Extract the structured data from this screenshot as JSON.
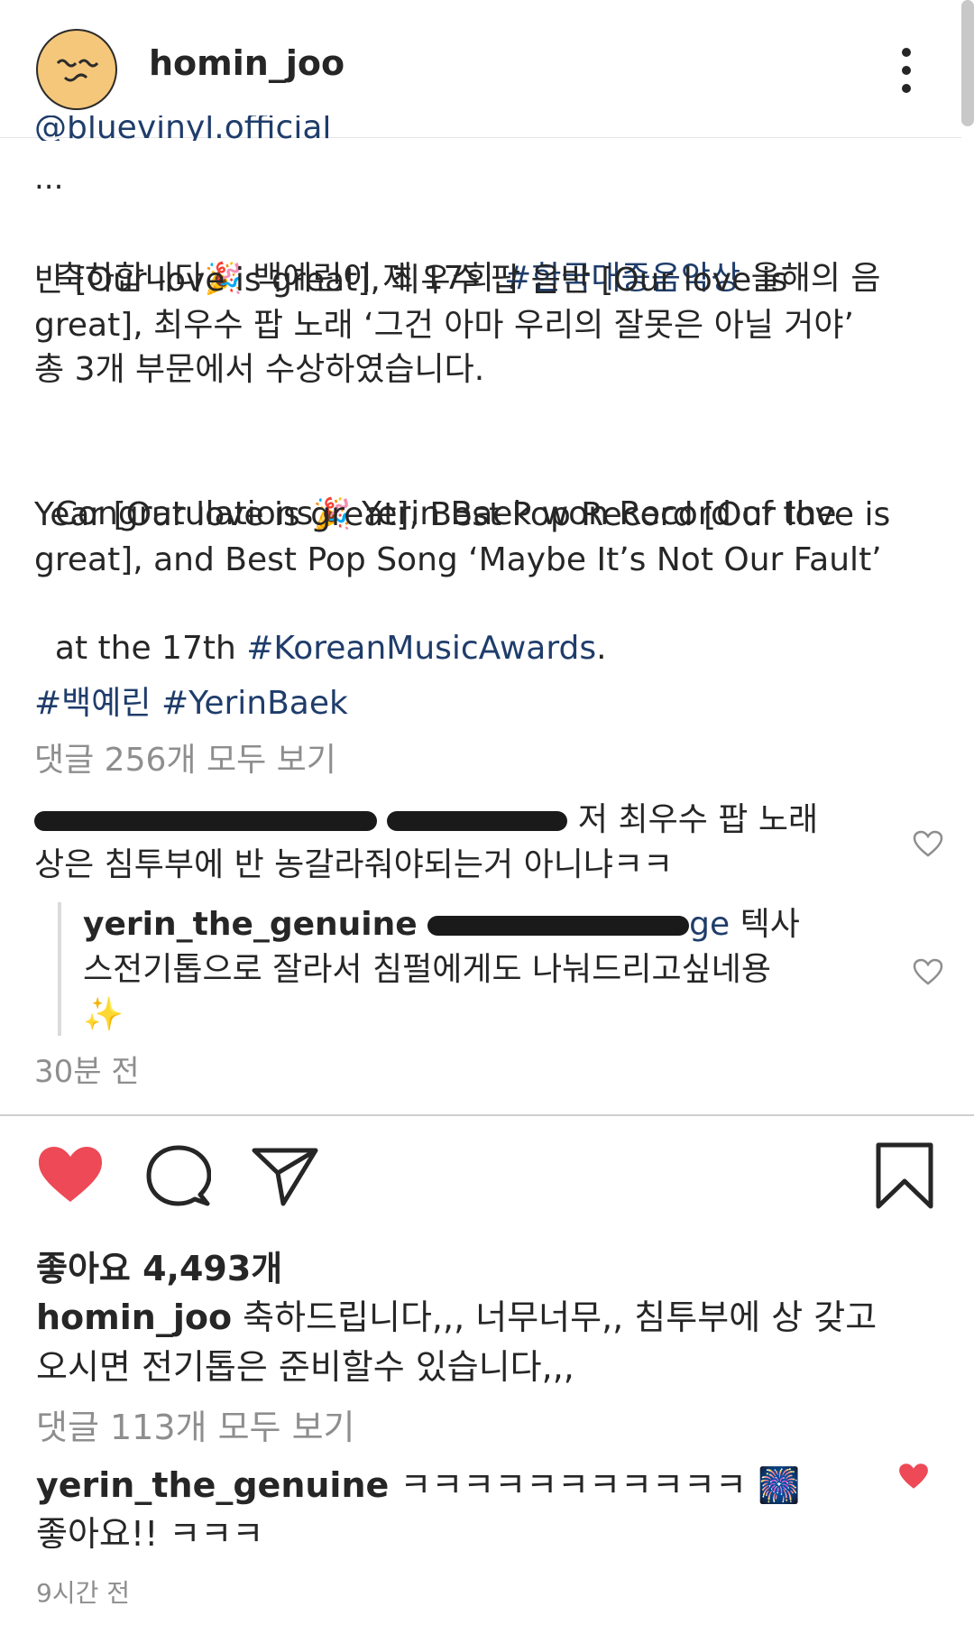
{
  "header": {
    "username": "homin_joo"
  },
  "caption": {
    "cut_mention": "@bluevinyl.official",
    "ellipsis": "...",
    "kr_line1_a": "축하합니다",
    "kr_line1_b": " 백예린이 제 17회 ",
    "kr_hashtag": "#한국대중음악상",
    "kr_line1_c": " 올해의 음",
    "kr_line2": "반 [Our love is great], 최우수 팝 음반 [Our love is",
    "kr_line3": "great], 최우수 팝 노래 ‘그건 아마 우리의 잘못은 아닐 거야’",
    "kr_line4": "총 3개 부문에서 수상하였습니다.",
    "en_line1_a": "Congratulations",
    "en_line1_b": " Yerin Baek won Record of the",
    "en_line2": "Year [Our love is great], Best Pop Record [Our love is",
    "en_line3": "great], and Best Pop Song ‘Maybe It’s Not Our Fault’",
    "en_line4_a": "at the 17th ",
    "en_hashtag": "#KoreanMusicAwards",
    "en_line4_b": ".",
    "hashtags": "#백예린 #YerinBaek",
    "view_all_comments": "댓글 256개 모두 보기",
    "party_icon": "party-popper-emoji"
  },
  "comments": [
    {
      "text_line1": " 저 최우수 팝 노래",
      "text_line2": "상은 침투부에 반 농갈라줘야되는거 아니냐ㅋㅋ"
    },
    {
      "username": "yerin_the_genuine",
      "mention_visible": "ge",
      "text_line1": " 텍사",
      "text_line2": "스전기톱으로 잘라서 침펄에게도 나눠드리고싶네용",
      "emoji": "✨"
    }
  ],
  "comment_time": "30분 전",
  "actions": {
    "like_icon": "heart-filled-icon",
    "comment_icon": "comment-bubble-icon",
    "share_icon": "paper-plane-icon",
    "save_icon": "bookmark-icon",
    "like_color": "#ed4956"
  },
  "post": {
    "likes": "좋아요 4,493개",
    "caption_user": "homin_joo",
    "caption_line1": " 축하드립니다,,, 너무너무,, 침투부에 상 갖고",
    "caption_line2": "오시면 전기톱은 준비할수 있습니다,,,",
    "view_all_comments": "댓글 113개 모두 보기",
    "reply_user": "yerin_the_genuine",
    "reply_text1": " ㅋㅋㅋㅋㅋㅋㅋㅋㅋㅋㅋ ",
    "reply_emoji": "🎆",
    "reply_text2": "좋아요!! ㅋㅋㅋ",
    "time": "9시간 전"
  }
}
